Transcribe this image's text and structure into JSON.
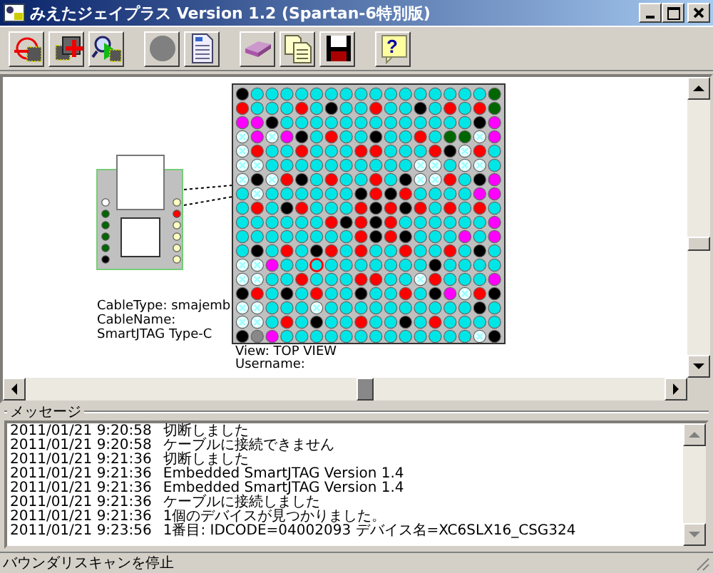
{
  "window": {
    "title": "みえたジェイプラス Version 1.2 (Spartan-6特別版)"
  },
  "toolbar": {
    "help_glyph": "?"
  },
  "canvas": {
    "cable_labels": [
      "CableType: smajemb",
      "CableName:",
      "SmartJTAG Type-C"
    ],
    "view_label": "View: TOP VIEW",
    "user_label": "Username:"
  },
  "messages": {
    "title": "メッセージ",
    "lines": [
      {
        "time": "2011/01/21 9:20:58",
        "text": "切断しました"
      },
      {
        "time": "2011/01/21 9:20:58",
        "text": "ケーブルに接続できません"
      },
      {
        "time": "2011/01/21 9:21:36",
        "text": "切断しました"
      },
      {
        "time": "2011/01/21 9:21:36",
        "text": "Embedded SmartJTAG Version 1.4"
      },
      {
        "time": "2011/01/21 9:21:36",
        "text": "Embedded SmartJTAG Version 1.4"
      },
      {
        "time": "2011/01/21 9:21:36",
        "text": "ケーブルに接続しました"
      },
      {
        "time": "2011/01/21 9:21:36",
        "text": "1個のデバイスが見つかりました。"
      },
      {
        "time": "2011/01/21 9:23:56",
        "text": "1番目: IDCODE=04002093 デバイス名=XC6SLX16_CSG324"
      }
    ]
  },
  "status_bar": "バウンダリスキャンを停止"
}
